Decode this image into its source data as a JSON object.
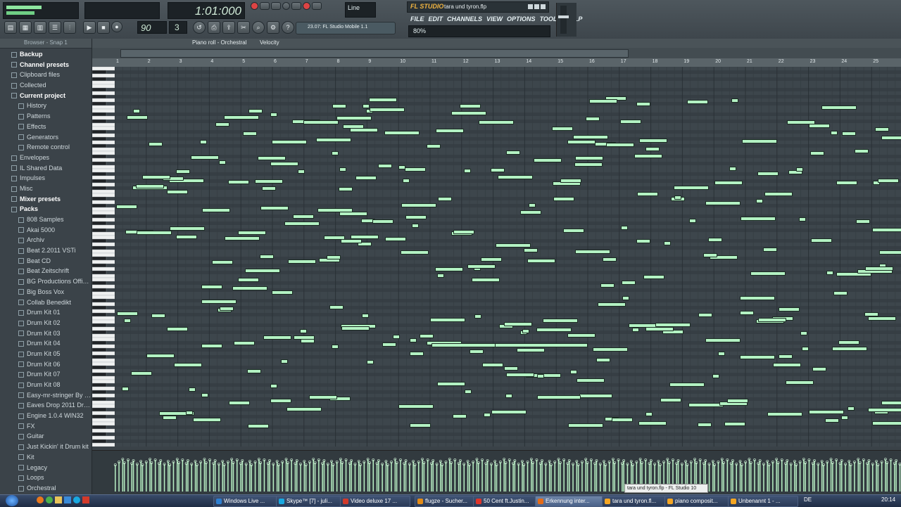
{
  "toolbar": {
    "time_display": "1:01:000",
    "tempo": "90",
    "pattern": "3",
    "hint_text": "23.07: FL Studio Mobile 1.1",
    "line_label": "Line",
    "title": "tara und tyron.flp",
    "zoom": "80%",
    "logo": "FL STUDIO",
    "menu": [
      "FILE",
      "EDIT",
      "CHANNELS",
      "VIEW",
      "OPTIONS",
      "TOOLS",
      "HELP"
    ]
  },
  "browser": {
    "title": "Browser - Snap 1",
    "items": [
      {
        "label": "Backup",
        "level": 0,
        "highlight": true
      },
      {
        "label": "Channel presets",
        "level": 0,
        "highlight": true
      },
      {
        "label": "Clipboard files",
        "level": 0,
        "highlight": false
      },
      {
        "label": "Collected",
        "level": 0,
        "highlight": false
      },
      {
        "label": "Current project",
        "level": 0,
        "highlight": true
      },
      {
        "label": "History",
        "level": 1,
        "highlight": false
      },
      {
        "label": "Patterns",
        "level": 1,
        "highlight": false
      },
      {
        "label": "Effects",
        "level": 1,
        "highlight": false
      },
      {
        "label": "Generators",
        "level": 1,
        "highlight": false
      },
      {
        "label": "Remote control",
        "level": 1,
        "highlight": false
      },
      {
        "label": "Envelopes",
        "level": 0,
        "highlight": false
      },
      {
        "label": "IL Shared Data",
        "level": 0,
        "highlight": false
      },
      {
        "label": "Impulses",
        "level": 0,
        "highlight": false
      },
      {
        "label": "Misc",
        "level": 0,
        "highlight": false
      },
      {
        "label": "Mixer presets",
        "level": 0,
        "highlight": true
      },
      {
        "label": "Packs",
        "level": 0,
        "highlight": true
      },
      {
        "label": "808 Samples",
        "level": 1,
        "highlight": false
      },
      {
        "label": "Akai 5000",
        "level": 1,
        "highlight": false
      },
      {
        "label": "Archiv",
        "level": 1,
        "highlight": false
      },
      {
        "label": "Beat 2.2011 VSTi",
        "level": 1,
        "highlight": false
      },
      {
        "label": "Beat CD",
        "level": 1,
        "highlight": false
      },
      {
        "label": "Beat Zeitschrift",
        "level": 1,
        "highlight": false
      },
      {
        "label": "BG Productions Offici...",
        "level": 1,
        "highlight": false
      },
      {
        "label": "Big Boss Vox",
        "level": 1,
        "highlight": false
      },
      {
        "label": "Collab Benedikt",
        "level": 1,
        "highlight": false
      },
      {
        "label": "Drum Kit 01",
        "level": 1,
        "highlight": false
      },
      {
        "label": "Drum Kit 02",
        "level": 1,
        "highlight": false
      },
      {
        "label": "Drum Kit 03",
        "level": 1,
        "highlight": false
      },
      {
        "label": "Drum Kit 04",
        "level": 1,
        "highlight": false
      },
      {
        "label": "Drum Kit 05",
        "level": 1,
        "highlight": false
      },
      {
        "label": "Drum Kit 06",
        "level": 1,
        "highlight": false
      },
      {
        "label": "Drum Kit 07",
        "level": 1,
        "highlight": false
      },
      {
        "label": "Drum Kit 08",
        "level": 1,
        "highlight": false
      },
      {
        "label": "Easy-mr-stringer By H...",
        "level": 1,
        "highlight": false
      },
      {
        "label": "Eaves Drop 2011 Dru...",
        "level": 1,
        "highlight": false
      },
      {
        "label": "Engine 1.0.4 WIN32",
        "level": 1,
        "highlight": false
      },
      {
        "label": "FX",
        "level": 1,
        "highlight": false
      },
      {
        "label": "Guitar",
        "level": 1,
        "highlight": false
      },
      {
        "label": "Just Kickin' it Drum kit",
        "level": 1,
        "highlight": false
      },
      {
        "label": "Kit",
        "level": 1,
        "highlight": false
      },
      {
        "label": "Legacy",
        "level": 1,
        "highlight": false
      },
      {
        "label": "Loops",
        "level": 1,
        "highlight": false
      },
      {
        "label": "Orchestral",
        "level": 1,
        "highlight": false
      }
    ]
  },
  "pianoroll": {
    "title": "Piano roll - Orchestral",
    "target": "Velocity",
    "bars": [
      "1",
      "2",
      "3",
      "4",
      "5",
      "6",
      "7",
      "8",
      "9",
      "10",
      "11",
      "12",
      "13",
      "14",
      "15",
      "16",
      "17",
      "18",
      "19",
      "20",
      "21",
      "22",
      "23",
      "24",
      "25"
    ],
    "tooltip": "tara und tyron.flp - FL Studio 10"
  },
  "taskbar": {
    "items": [
      {
        "label": "Windows Live ...",
        "active": false,
        "color": "#2d7fd1"
      },
      {
        "label": "Skype™ [7] - juli...",
        "active": false,
        "color": "#19a8e0"
      },
      {
        "label": "Video deluxe 17 ...",
        "active": false,
        "color": "#d23a2a"
      },
      {
        "label": "flugze - Sucher...",
        "active": false,
        "color": "#e38b16"
      },
      {
        "label": "50 Cent ft.Justin...",
        "active": false,
        "color": "#e0342a"
      },
      {
        "label": "Erkennung inter...",
        "active": true,
        "color": "#e56b17"
      },
      {
        "label": "tara und tyron.fl...",
        "active": false,
        "color": "#f5a623"
      },
      {
        "label": "piano composit...",
        "active": false,
        "color": "#f5a623"
      },
      {
        "label": "Unbenannt 1 - ...",
        "active": false,
        "color": "#f5a623"
      }
    ],
    "lang": "DE",
    "clock": "20:14"
  }
}
